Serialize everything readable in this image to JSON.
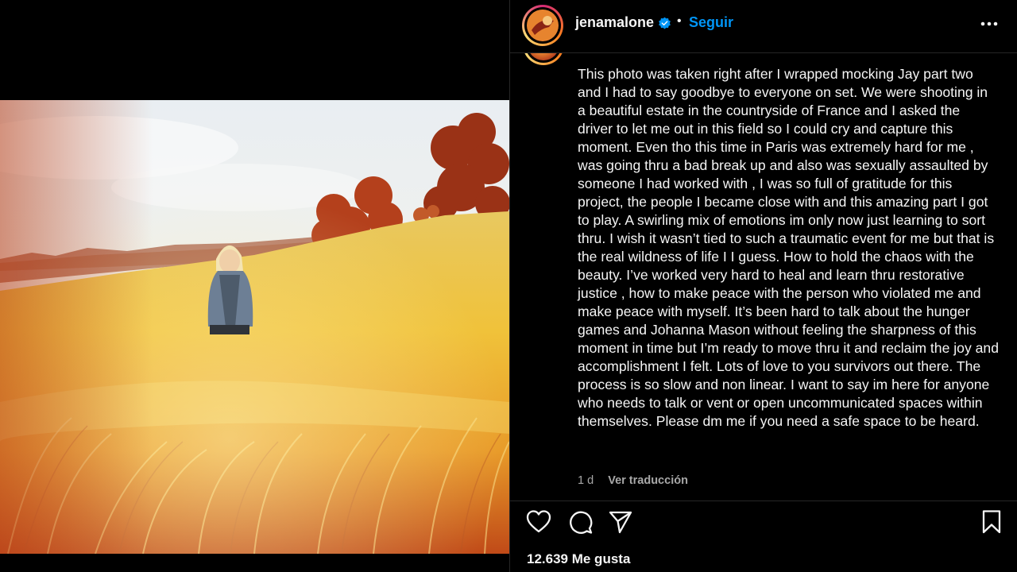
{
  "post": {
    "username": "jenamalone",
    "separator": "•",
    "follow_label": "Seguir",
    "caption": "This photo was taken right after I wrapped mocking Jay part two and I had to say goodbye to everyone on set. We were shooting in a beautiful estate in the countryside of France and I asked the driver to let me out in this field so I could cry and capture this moment. Even tho this time in Paris was extremely hard for me , was going thru a bad break up and also was sexually assaulted by someone I had worked with , I was so full of gratitude for this project, the people I became close with and this amazing part I got to play. A swirling mix of emotions im only now just learning to sort thru. I wish it wasn’t tied to such a traumatic event for me but that is the real wildness of life I I guess. How to hold the chaos with the beauty. I’ve worked very hard to heal and learn thru restorative justice , how to make peace with the person who violated me and make peace with myself. It’s been hard to talk about the hunger games and Johanna Mason without feeling the sharpness of this moment in time but I’m ready to move thru it and reclaim the joy and accomplishment I felt. Lots of love to you survivors out there. The process is so slow and non linear. I want to say im here for anyone who needs to talk or vent or open uncommunicated spaces within themselves. Please dm me if you need a safe space to be heard.",
    "time": "1 d",
    "translate_label": "Ver traducción",
    "likes": "12.639 Me gusta"
  },
  "icons": {
    "verified": "verified-badge-icon",
    "more": "more-options-icon",
    "like": "heart-icon",
    "comment": "comment-icon",
    "share": "send-icon",
    "save": "bookmark-icon"
  },
  "colors": {
    "accent": "#0095f6",
    "background": "#000000",
    "text": "#f5f5f5",
    "muted": "#a8a8a8"
  }
}
